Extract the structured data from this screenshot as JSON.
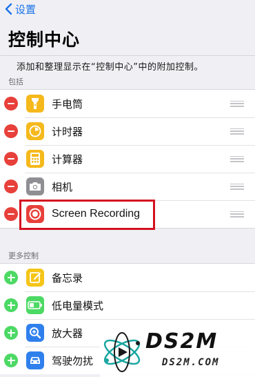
{
  "nav": {
    "back_label": "设置"
  },
  "title": "控制中心",
  "description": "添加和整理显示在“控制中心”中的附加控制。",
  "included": {
    "header": "包括",
    "items": [
      {
        "label": "手电筒",
        "icon": "flashlight-icon",
        "icon_bg": "#f5b91c"
      },
      {
        "label": "计时器",
        "icon": "timer-icon",
        "icon_bg": "#f5b91c"
      },
      {
        "label": "计算器",
        "icon": "calculator-icon",
        "icon_bg": "#f5b91c"
      },
      {
        "label": "相机",
        "icon": "camera-icon",
        "icon_bg": "#8e8e93"
      },
      {
        "label": "Screen Recording",
        "icon": "screen-recording-icon",
        "icon_bg": "#e8403a"
      }
    ]
  },
  "more": {
    "header": "更多控制",
    "items": [
      {
        "label": "备忘录",
        "icon": "notes-icon",
        "icon_bg": "#f5c518"
      },
      {
        "label": "低电量模式",
        "icon": "battery-icon",
        "icon_bg": "#4cd964"
      },
      {
        "label": "放大器",
        "icon": "magnifier-icon",
        "icon_bg": "#2f80ed"
      },
      {
        "label": "驾驶勿扰",
        "icon": "car-icon",
        "icon_bg": "#2f80ed"
      }
    ]
  },
  "watermark": {
    "title": "DS2M",
    "domain": "DS2M.COM"
  },
  "colors": {
    "remove": "#e8403a",
    "add": "#4cd964",
    "link": "#1a73e8",
    "highlight": "#d4101f",
    "background": "#efeff4"
  }
}
